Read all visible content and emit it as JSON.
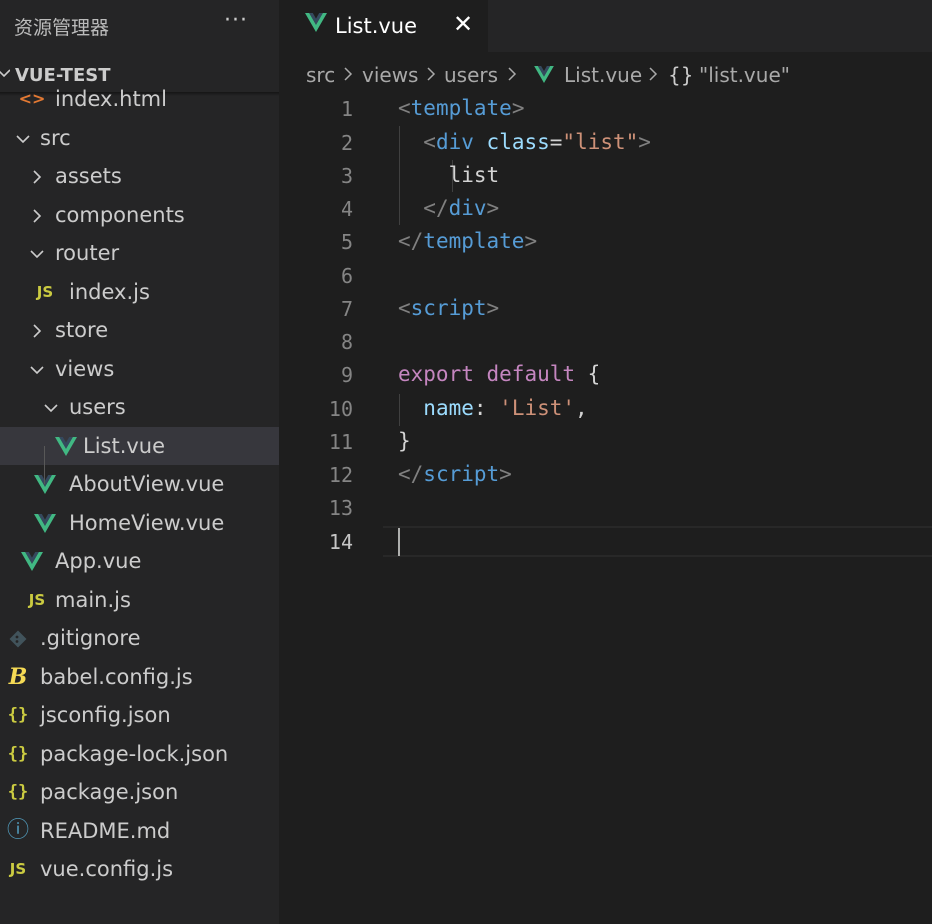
{
  "explorer": {
    "title": "资源管理器",
    "more": "···",
    "folder": "VUE-TEST",
    "items": [
      {
        "label": "index.html",
        "icon": "html-icon"
      },
      {
        "label": "src",
        "icon": "chevron-down-icon"
      },
      {
        "label": "assets",
        "icon": "chevron-right-icon"
      },
      {
        "label": "components",
        "icon": "chevron-right-icon"
      },
      {
        "label": "router",
        "icon": "chevron-down-icon"
      },
      {
        "label": "index.js",
        "icon": "js-icon"
      },
      {
        "label": "store",
        "icon": "chevron-right-icon"
      },
      {
        "label": "views",
        "icon": "chevron-down-icon"
      },
      {
        "label": "users",
        "icon": "chevron-down-icon"
      },
      {
        "label": "List.vue",
        "icon": "vue-icon"
      },
      {
        "label": "AboutView.vue",
        "icon": "vue-icon"
      },
      {
        "label": "HomeView.vue",
        "icon": "vue-icon"
      },
      {
        "label": "App.vue",
        "icon": "vue-icon"
      },
      {
        "label": "main.js",
        "icon": "js-icon"
      },
      {
        "label": ".gitignore",
        "icon": "git-icon"
      },
      {
        "label": "babel.config.js",
        "icon": "babel-icon"
      },
      {
        "label": "jsconfig.json",
        "icon": "json-icon"
      },
      {
        "label": "package-lock.json",
        "icon": "json-icon"
      },
      {
        "label": "package.json",
        "icon": "json-icon"
      },
      {
        "label": "README.md",
        "icon": "info-icon"
      },
      {
        "label": "vue.config.js",
        "icon": "js-icon"
      }
    ],
    "selected": "List.vue"
  },
  "tab": {
    "label": "List.vue",
    "close": "✕",
    "icon": "vue-icon"
  },
  "breadcrumb": {
    "items": [
      "src",
      "views",
      "users",
      "List.vue",
      "\"list.vue\""
    ],
    "symbol": "{}"
  },
  "icons": {
    "html": "<>",
    "js": "JS",
    "json": "{}",
    "info": "ⓘ",
    "babel": "B"
  },
  "colors": {
    "accent_vue": "#41b883",
    "tag": "#569cd6",
    "attr": "#9cdcfe",
    "string": "#ce9178",
    "keyword": "#c586c0",
    "bracket": "#808080"
  },
  "editor": {
    "active_line": 14,
    "line_numbers": [
      "1",
      "2",
      "3",
      "4",
      "5",
      "6",
      "7",
      "8",
      "9",
      "10",
      "11",
      "12",
      "13",
      "14"
    ],
    "lines": [
      [
        {
          "t": "<",
          "c": "#808080"
        },
        {
          "t": "template",
          "c": "#569cd6"
        },
        {
          "t": ">",
          "c": "#808080"
        }
      ],
      [
        {
          "t": "  ",
          "c": "#d4d4d4"
        },
        {
          "t": "<",
          "c": "#808080"
        },
        {
          "t": "div",
          "c": "#569cd6"
        },
        {
          "t": " ",
          "c": "#d4d4d4"
        },
        {
          "t": "class",
          "c": "#9cdcfe"
        },
        {
          "t": "=",
          "c": "#d4d4d4"
        },
        {
          "t": "\"list\"",
          "c": "#ce9178"
        },
        {
          "t": ">",
          "c": "#808080"
        }
      ],
      [
        {
          "t": "    list",
          "c": "#d4d4d4"
        }
      ],
      [
        {
          "t": "  ",
          "c": "#d4d4d4"
        },
        {
          "t": "</",
          "c": "#808080"
        },
        {
          "t": "div",
          "c": "#569cd6"
        },
        {
          "t": ">",
          "c": "#808080"
        }
      ],
      [
        {
          "t": "</",
          "c": "#808080"
        },
        {
          "t": "template",
          "c": "#569cd6"
        },
        {
          "t": ">",
          "c": "#808080"
        }
      ],
      [],
      [
        {
          "t": "<",
          "c": "#808080"
        },
        {
          "t": "script",
          "c": "#569cd6"
        },
        {
          "t": ">",
          "c": "#808080"
        }
      ],
      [],
      [
        {
          "t": "export",
          "c": "#c586c0"
        },
        {
          "t": " ",
          "c": "#d4d4d4"
        },
        {
          "t": "default",
          "c": "#c586c0"
        },
        {
          "t": " {",
          "c": "#d4d4d4"
        }
      ],
      [
        {
          "t": "  ",
          "c": "#d4d4d4"
        },
        {
          "t": "name",
          "c": "#9cdcfe"
        },
        {
          "t": ": ",
          "c": "#d4d4d4"
        },
        {
          "t": "'List'",
          "c": "#ce9178"
        },
        {
          "t": ",",
          "c": "#d4d4d4"
        }
      ],
      [
        {
          "t": "}",
          "c": "#d4d4d4"
        }
      ],
      [
        {
          "t": "</",
          "c": "#808080"
        },
        {
          "t": "script",
          "c": "#569cd6"
        },
        {
          "t": ">",
          "c": "#808080"
        }
      ],
      [],
      []
    ]
  }
}
